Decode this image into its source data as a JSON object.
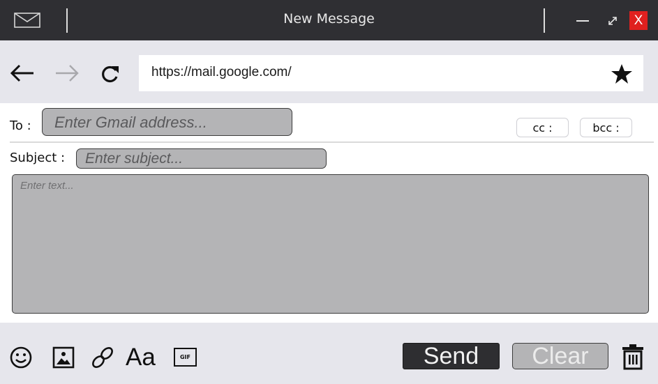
{
  "window": {
    "title": "New Message",
    "minimize_symbol": "—",
    "maximize_symbol": "⤢",
    "close_label": "X",
    "close_color": "#e0201f"
  },
  "navbar": {
    "back_icon": "arrow-left-icon",
    "forward_icon": "arrow-right-icon",
    "reload_icon": "reload-icon",
    "url": "https://mail.google.com/",
    "bookmark_icon": "star-icon"
  },
  "compose": {
    "to_label": "To :",
    "to_placeholder": "Enter Gmail address...",
    "cc_label": "cc :",
    "bcc_label": "bcc :",
    "subject_label": "Subject :",
    "subject_placeholder": "Enter subject...",
    "body_placeholder": "Enter text..."
  },
  "toolbar": {
    "tools": [
      "smiley-icon",
      "image-icon",
      "link-icon",
      "text-format-icon",
      "gif-icon"
    ],
    "format_label": "Aa",
    "gif_label": "GIF",
    "send_label": "Send",
    "clear_label": "Clear",
    "delete_icon": "trash-icon"
  }
}
